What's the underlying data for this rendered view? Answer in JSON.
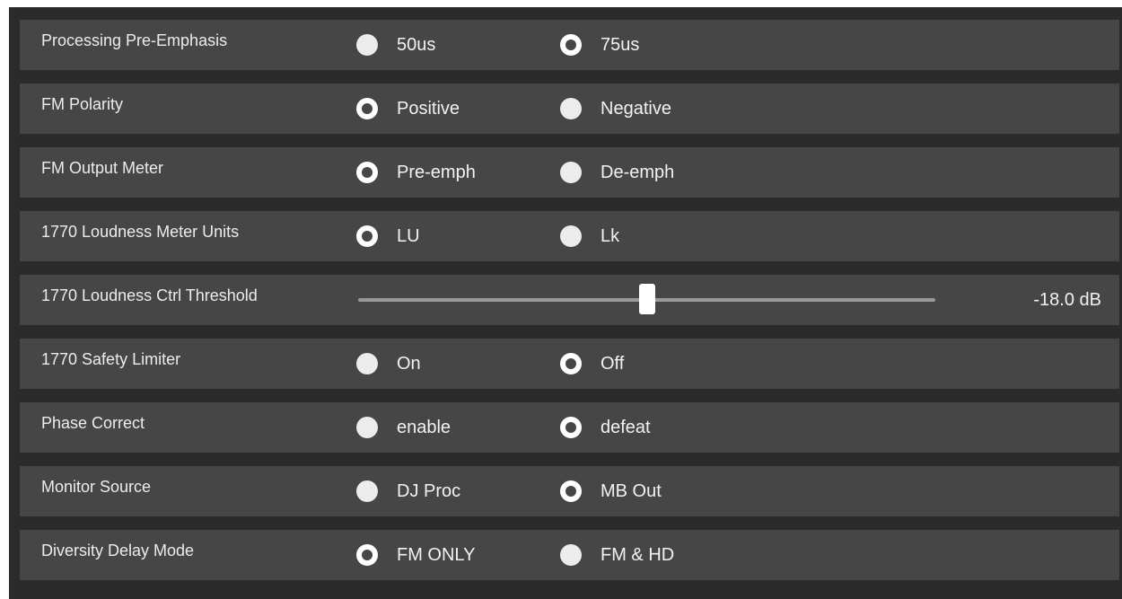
{
  "colors": {
    "panel_background": "#2b2b2b",
    "row_background": "#464646",
    "text": "#ececec",
    "radio": "#ffffff",
    "slider_track": "#999999"
  },
  "settings": [
    {
      "label": "Processing Pre-Emphasis",
      "options": [
        "50us",
        "75us"
      ],
      "selected": 1
    },
    {
      "label": "FM Polarity",
      "options": [
        "Positive",
        "Negative"
      ],
      "selected": 0
    },
    {
      "label": "FM Output Meter",
      "options": [
        "Pre-emph",
        "De-emph"
      ],
      "selected": 0
    },
    {
      "label": "1770 Loudness Meter Units",
      "options": [
        "LU",
        "Lk"
      ],
      "selected": 0
    },
    {
      "label": "1770 Loudness Ctrl Threshold",
      "type": "slider",
      "value_text": "-18.0 dB",
      "position_fraction": 0.5
    },
    {
      "label": "1770 Safety Limiter",
      "options": [
        "On",
        "Off"
      ],
      "selected": 1
    },
    {
      "label": "Phase Correct",
      "options": [
        "enable",
        "defeat"
      ],
      "selected": 1
    },
    {
      "label": "Monitor Source",
      "options": [
        "DJ Proc",
        "MB Out"
      ],
      "selected": 1
    },
    {
      "label": "Diversity Delay Mode",
      "options": [
        "FM ONLY",
        "FM & HD"
      ],
      "selected": 0
    }
  ]
}
